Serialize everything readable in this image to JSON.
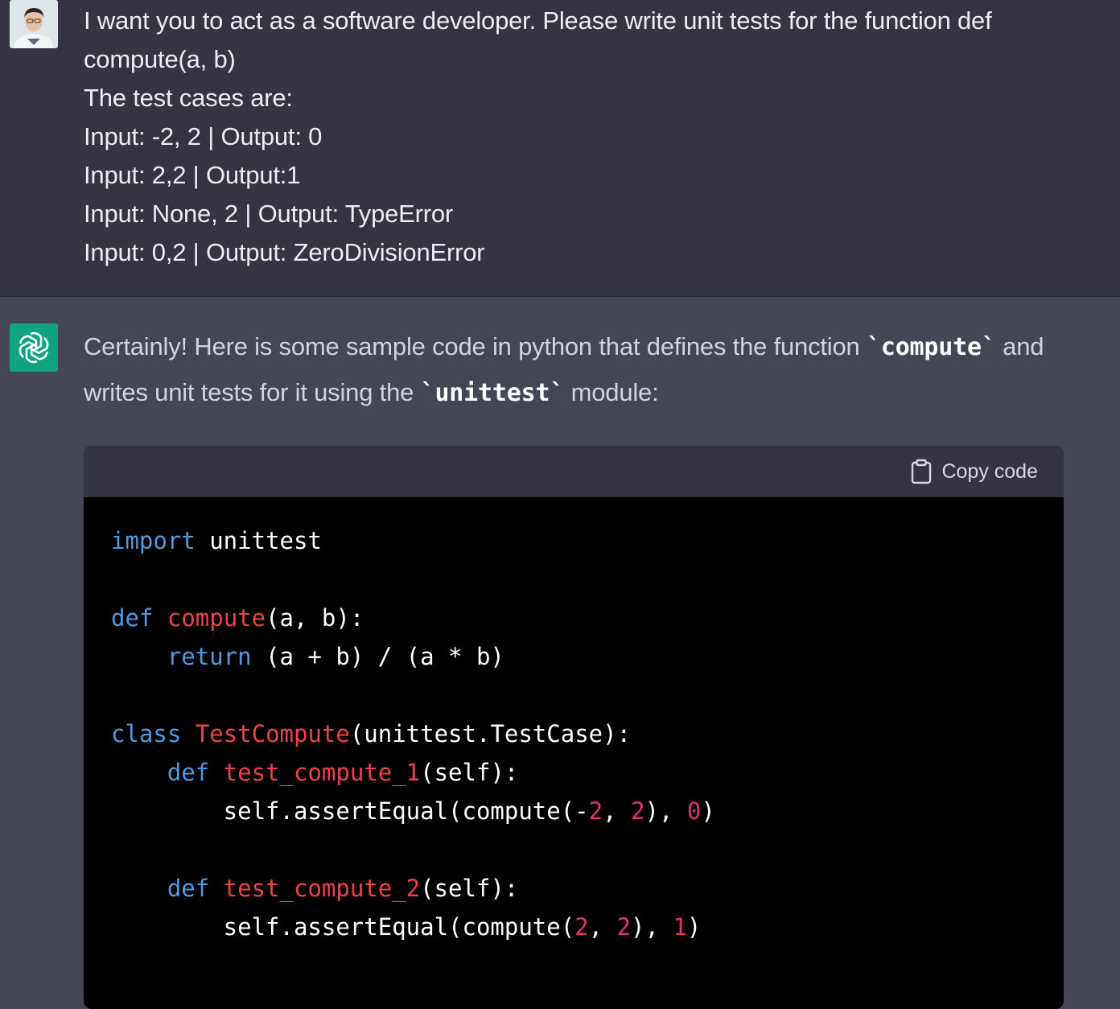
{
  "user": {
    "avatar_icon": "user-avatar-photo",
    "lines": [
      "I want you to act as a software developer. Please write unit tests for the function def",
      "compute(a, b)",
      "The test cases are:",
      "Input: -2, 2 | Output: 0",
      "Input: 2,2 | Output:1",
      "Input: None, 2 | Output: TypeError",
      "Input: 0,2 | Output: ZeroDivisionError"
    ]
  },
  "assistant": {
    "avatar_icon": "openai-logo-icon",
    "intro_part1": "Certainly! Here is some sample code in python that defines the function ",
    "intro_code1": "`compute`",
    "intro_part2": " and writes unit tests for it using the ",
    "intro_code2": "`unittest`",
    "intro_part3": " module:",
    "code_block": {
      "copy_label": "Copy code",
      "copy_icon": "clipboard-icon",
      "lines": [
        [
          {
            "t": "import",
            "c": "kw"
          },
          {
            "t": " unittest",
            "c": ""
          }
        ],
        [],
        [
          {
            "t": "def",
            "c": "kw"
          },
          {
            "t": " ",
            "c": ""
          },
          {
            "t": "compute",
            "c": "fn"
          },
          {
            "t": "(a, b):",
            "c": ""
          }
        ],
        [
          {
            "t": "    ",
            "c": ""
          },
          {
            "t": "return",
            "c": "kw"
          },
          {
            "t": " (a + b) / (a * b)",
            "c": ""
          }
        ],
        [],
        [
          {
            "t": "class",
            "c": "kw"
          },
          {
            "t": " ",
            "c": ""
          },
          {
            "t": "TestCompute",
            "c": "fn"
          },
          {
            "t": "(unittest.TestCase):",
            "c": ""
          }
        ],
        [
          {
            "t": "    ",
            "c": ""
          },
          {
            "t": "def",
            "c": "kw"
          },
          {
            "t": " ",
            "c": ""
          },
          {
            "t": "test_compute_1",
            "c": "fn"
          },
          {
            "t": "(self):",
            "c": ""
          }
        ],
        [
          {
            "t": "        self.assertEqual(compute(-",
            "c": ""
          },
          {
            "t": "2",
            "c": "num"
          },
          {
            "t": ", ",
            "c": ""
          },
          {
            "t": "2",
            "c": "num"
          },
          {
            "t": "), ",
            "c": ""
          },
          {
            "t": "0",
            "c": "num"
          },
          {
            "t": ")",
            "c": ""
          }
        ],
        [],
        [
          {
            "t": "    ",
            "c": ""
          },
          {
            "t": "def",
            "c": "kw"
          },
          {
            "t": " ",
            "c": ""
          },
          {
            "t": "test_compute_2",
            "c": "fn"
          },
          {
            "t": "(self):",
            "c": ""
          }
        ],
        [
          {
            "t": "        self.assertEqual(compute(",
            "c": ""
          },
          {
            "t": "2",
            "c": "num"
          },
          {
            "t": ", ",
            "c": ""
          },
          {
            "t": "2",
            "c": "num"
          },
          {
            "t": "), ",
            "c": ""
          },
          {
            "t": "1",
            "c": "num"
          },
          {
            "t": ")",
            "c": ""
          }
        ]
      ]
    }
  },
  "colors": {
    "user_bg": "#343541",
    "assistant_bg": "#444654",
    "gpt_avatar": "#10a37f",
    "keyword": "#4f9ae0",
    "function_name": "#ef4146",
    "number": "#df3079"
  }
}
